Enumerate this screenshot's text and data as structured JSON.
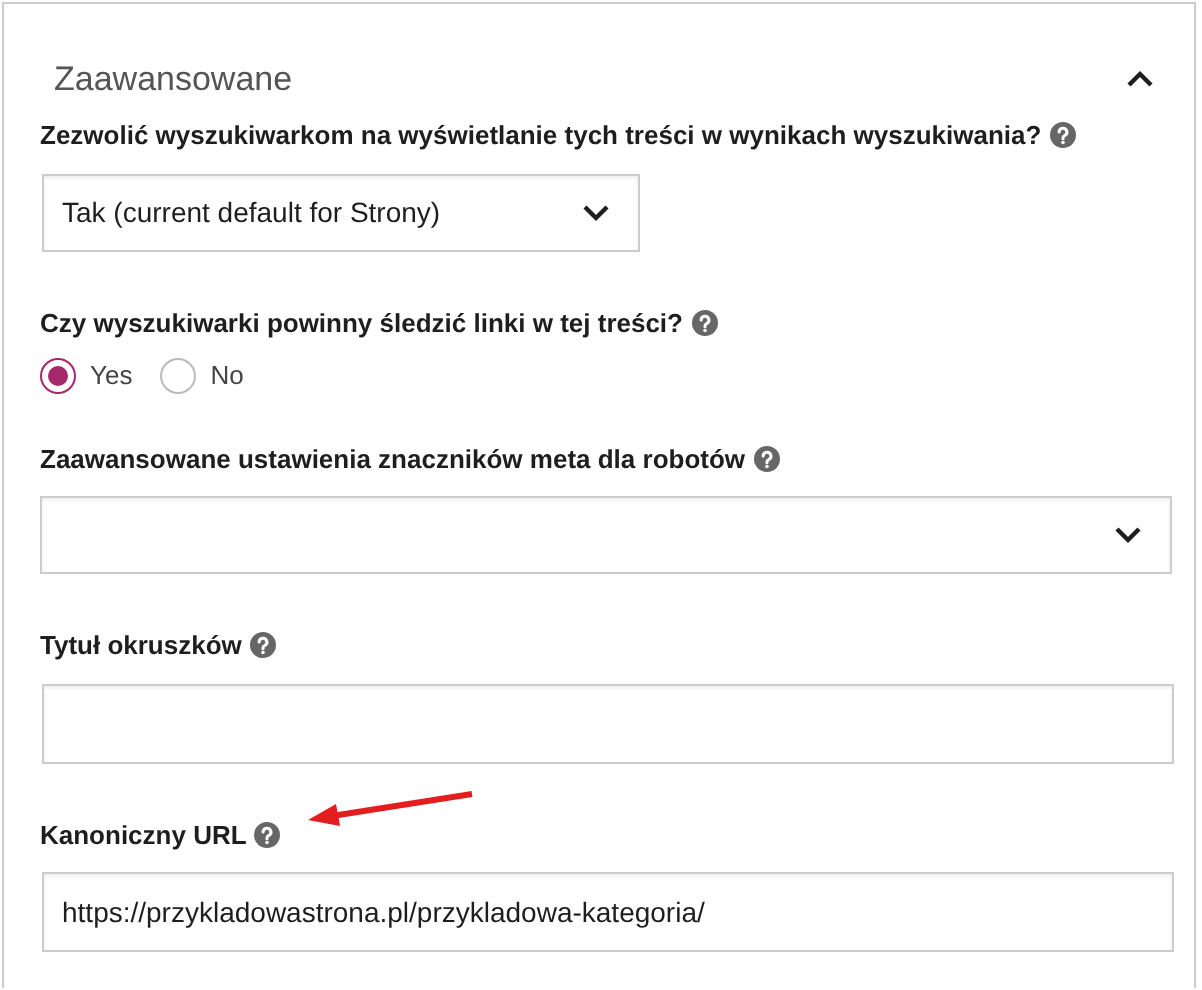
{
  "section": {
    "title": "Zaawansowane",
    "expanded": true
  },
  "fields": [
    {
      "kind": "select",
      "label": "Zezwolić wyszukiwarkom na wyświetlanie tych treści w wynikach wyszukiwania?",
      "value": "Tak (current default for Strony)"
    },
    {
      "kind": "radio",
      "label": "Czy wyszukiwarki powinny śledzić linki w tej treści?",
      "options": [
        {
          "label": "Yes",
          "selected": true
        },
        {
          "label": "No",
          "selected": false
        }
      ]
    },
    {
      "kind": "select",
      "label": "Zaawansowane ustawienia znaczników meta dla robotów"
    },
    {
      "kind": "text",
      "label": "Tytuł okruszków"
    },
    {
      "kind": "text",
      "label": "Kanoniczny URL",
      "value": "https://przykladowastrona.pl/przykladowa-kategoria/",
      "annotated": true
    }
  ]
}
